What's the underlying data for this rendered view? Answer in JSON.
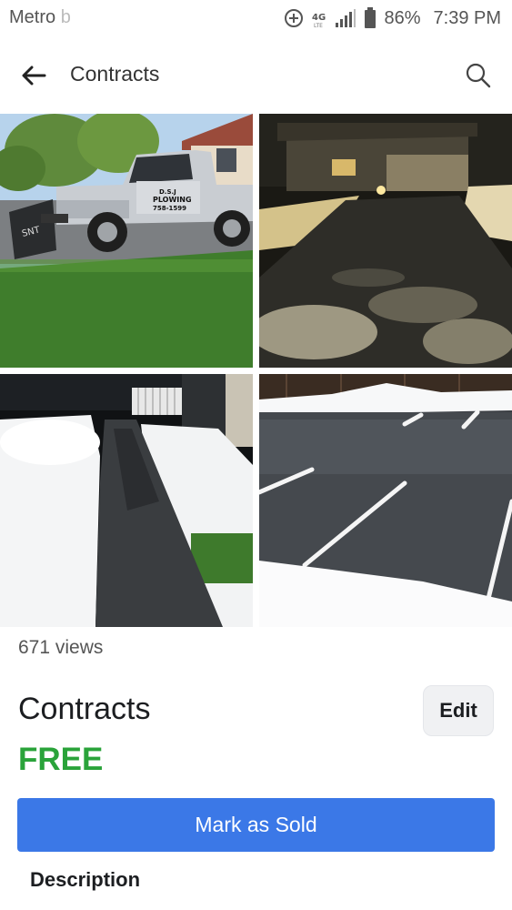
{
  "status_bar": {
    "carrier": "Metro",
    "carrier_faded": "b",
    "battery": "86%",
    "time": "7:39 PM",
    "network": "4G"
  },
  "app_bar": {
    "title": "Contracts",
    "back_icon": "arrow-left-icon",
    "search_icon": "search-icon"
  },
  "photos": [
    {
      "name": "photo-plow-truck",
      "truck_text": [
        "D.S.J",
        "PLOWING",
        "758-1599"
      ]
    },
    {
      "name": "photo-plowed-driveway-night"
    },
    {
      "name": "photo-shoveled-path"
    },
    {
      "name": "photo-parking-lot"
    }
  ],
  "listing": {
    "views": "671 views",
    "title": "Contracts",
    "edit_label": "Edit",
    "price": "FREE",
    "mark_sold_label": "Mark as Sold",
    "description_heading": "Description"
  },
  "colors": {
    "price_green": "#2aa33a",
    "primary_blue": "#3b78e7"
  }
}
